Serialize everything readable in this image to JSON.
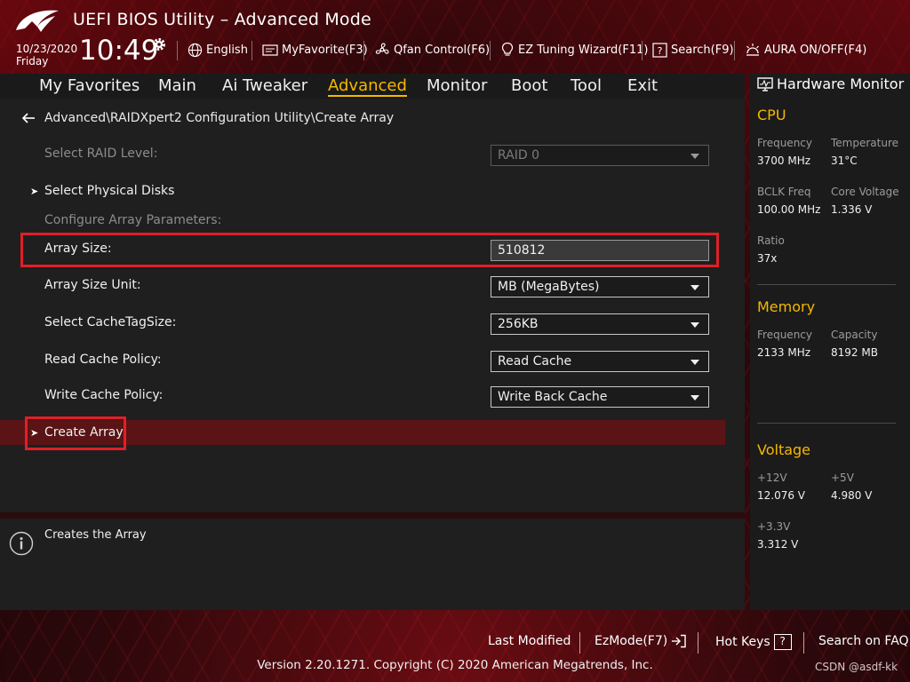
{
  "header": {
    "title": "UEFI BIOS Utility – Advanced Mode",
    "date": "10/23/2020",
    "day": "Friday",
    "time": "10:49",
    "items": [
      {
        "label": "English",
        "icon": "globe-icon"
      },
      {
        "label": "MyFavorite(F3)",
        "icon": "favorite-icon"
      },
      {
        "label": "Qfan Control(F6)",
        "icon": "fan-icon"
      },
      {
        "label": "EZ Tuning Wizard(F11)",
        "icon": "lightbulb-icon"
      },
      {
        "label": "Search(F9)",
        "icon": "search-help-icon"
      },
      {
        "label": "AURA ON/OFF(F4)",
        "icon": "aura-icon"
      }
    ]
  },
  "nav": {
    "tabs": [
      "My Favorites",
      "Main",
      "Ai Tweaker",
      "Advanced",
      "Monitor",
      "Boot",
      "Tool",
      "Exit"
    ],
    "active": "Advanced"
  },
  "main": {
    "breadcrumb": "Advanced\\RAIDXpert2 Configuration Utility\\Create Array",
    "select_raid_level": {
      "label": "Select RAID Level:",
      "value": "RAID 0"
    },
    "select_physical_disks": "Select Physical Disks",
    "configure_params": "Configure Array Parameters:",
    "array_size": {
      "label": "Array Size:",
      "value": "510812"
    },
    "array_size_unit": {
      "label": "Array Size Unit:",
      "value": "MB (MegaBytes)"
    },
    "cache_tag_size": {
      "label": "Select CacheTagSize:",
      "value": "256KB"
    },
    "read_cache_policy": {
      "label": "Read Cache Policy:",
      "value": "Read Cache"
    },
    "write_cache_policy": {
      "label": "Write Cache Policy:",
      "value": "Write Back Cache"
    },
    "create_array": "Create Array"
  },
  "help": {
    "text": "Creates the Array"
  },
  "hardware_monitor": {
    "title": "Hardware Monitor",
    "cpu": {
      "title": "CPU",
      "frequency_label": "Frequency",
      "frequency": "3700 MHz",
      "temperature_label": "Temperature",
      "temperature": "31°C",
      "bclk_label": "BCLK Freq",
      "bclk": "100.00 MHz",
      "core_voltage_label": "Core Voltage",
      "core_voltage": "1.336 V",
      "ratio_label": "Ratio",
      "ratio": "37x"
    },
    "memory": {
      "title": "Memory",
      "frequency_label": "Frequency",
      "frequency": "2133 MHz",
      "capacity_label": "Capacity",
      "capacity": "8192 MB"
    },
    "voltage": {
      "title": "Voltage",
      "v12_label": "+12V",
      "v12": "12.076 V",
      "v5_label": "+5V",
      "v5": "4.980 V",
      "v33_label": "+3.3V",
      "v33": "3.312 V"
    }
  },
  "footer": {
    "last_modified": "Last Modified",
    "ezmode": "EzMode(F7)",
    "hotkeys": "Hot Keys",
    "hotkeys_key": "?",
    "faq": "Search on FAQ",
    "version": "Version 2.20.1271. Copyright (C) 2020 American Megatrends, Inc.",
    "watermark": "CSDN @asdf-kk"
  },
  "colors": {
    "accent": "#f5b800",
    "highlight_border": "#e01f27",
    "selected_row": "#5a1416"
  }
}
